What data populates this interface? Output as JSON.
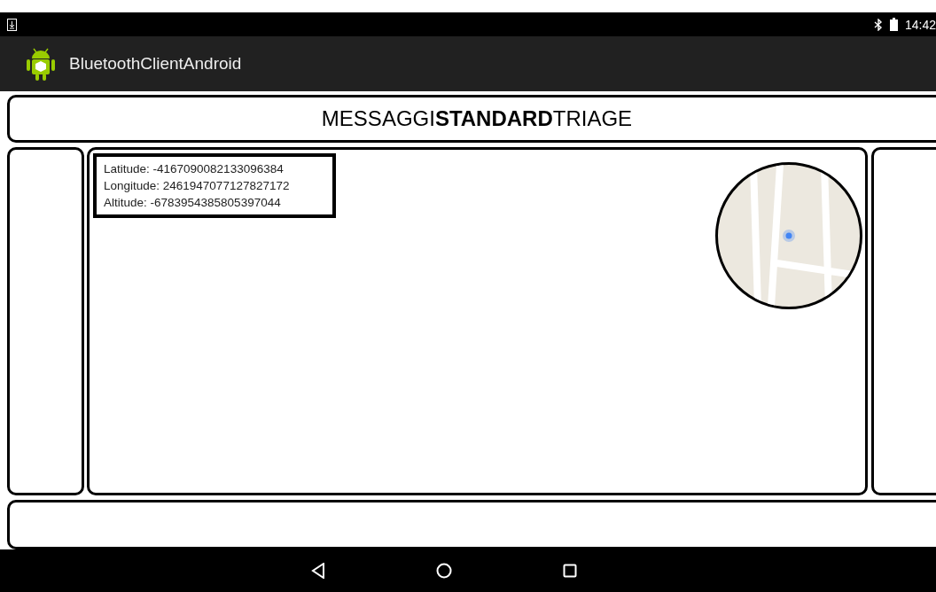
{
  "status_bar": {
    "time": "14:42"
  },
  "app_bar": {
    "title": "BluetoothClientAndroid"
  },
  "header": {
    "title": "MESSAGGI**STANDARD**TRIAGE"
  },
  "location": {
    "lines": [
      "Latitude: -4167090082133096384",
      "Longitude: 2461947077127827172",
      "Altitude: -6783954385805397044"
    ]
  }
}
